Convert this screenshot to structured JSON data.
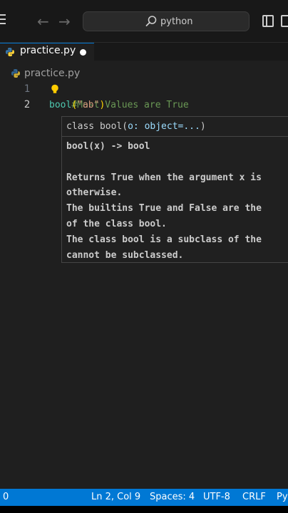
{
  "titlebar": {
    "search_text": "python"
  },
  "tab": {
    "label": "practice.py"
  },
  "breadcrumb": {
    "label": "practice.py"
  },
  "editor": {
    "lines": [
      {
        "number": "1",
        "comment": "#Most Values are True"
      },
      {
        "number": "2",
        "fn": "bool",
        "open": "(",
        "string": "\"ab\"",
        "close": ")"
      }
    ]
  },
  "hover": {
    "signature_prefix": "class bool(",
    "signature_param": "o: object=...",
    "signature_suffix": ")",
    "return_sig": "bool(x) -> bool",
    "doc_lines": [
      "Returns True when the argument x is",
      "otherwise.",
      "The builtins True and False are the",
      "of the class bool.",
      "The class bool is a subclass of the",
      "cannot be subclassed."
    ]
  },
  "statusbar": {
    "left": "0",
    "position": "Ln 2, Col 9",
    "spaces": "Spaces: 4",
    "encoding": "UTF-8",
    "eol": "CRLF",
    "language": "Py"
  },
  "colors": {
    "accent": "#0078d4",
    "comment": "#6a9955",
    "builtin": "#4ec9b0",
    "string": "#ce9178",
    "bracket": "#ffd700",
    "python_blue": "#3776ab",
    "python_yellow": "#ffd43b"
  }
}
